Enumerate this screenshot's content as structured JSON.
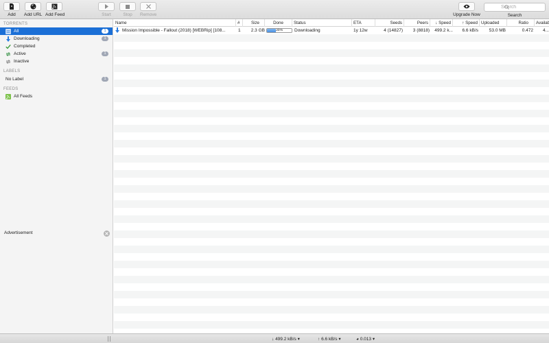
{
  "toolbar": {
    "add": "Add",
    "add_url": "Add URL",
    "add_feed": "Add Feed",
    "start": "Start",
    "stop": "Stop",
    "remove": "Remove",
    "upgrade": "Upgrade Now",
    "search_label": "Search",
    "search_placeholder": "Search"
  },
  "sidebar": {
    "torrents_header": "TORRENTS",
    "items": [
      {
        "label": "All",
        "count": "1"
      },
      {
        "label": "Downloading",
        "count": "1"
      },
      {
        "label": "Completed"
      },
      {
        "label": "Active",
        "count": "1"
      },
      {
        "label": "Inactive"
      }
    ],
    "labels_header": "LABELS",
    "labels": [
      {
        "label": "No Label",
        "count": "1"
      }
    ],
    "feeds_header": "FEEDS",
    "feeds": [
      {
        "label": "All Feeds"
      }
    ],
    "advertisement": "Advertisement"
  },
  "table": {
    "columns": [
      "Name",
      "#",
      "Size",
      "Done",
      "Status",
      "ETA",
      "Seeds",
      "Peers",
      "↓ Speed",
      "↑ Speed",
      "Uploaded",
      "Ratio",
      "Availability"
    ],
    "rows": [
      {
        "name": "Mission Impossible - Fallout (2018) [WEBRip] [108...",
        "num": "1",
        "size": "2.3 GB",
        "done": "35%",
        "done_fraction": 0.35,
        "status": "Downloading",
        "eta": "1y 12w",
        "seeds": "4 (14827)",
        "peers": "3 (8818)",
        "down_speed": "499.2 k...",
        "up_speed": "6.6 kB/s",
        "uploaded": "53.0 MB",
        "ratio": "0.472",
        "availability": "4..."
      }
    ]
  },
  "statusbar": {
    "down": "499.2 kB/s",
    "up": "6.6 kB/s",
    "ratio": "0.013"
  },
  "colors": {
    "selection": "#1b6fd6",
    "progress": "#4a90e2",
    "download_arrow": "#2a7de1"
  }
}
